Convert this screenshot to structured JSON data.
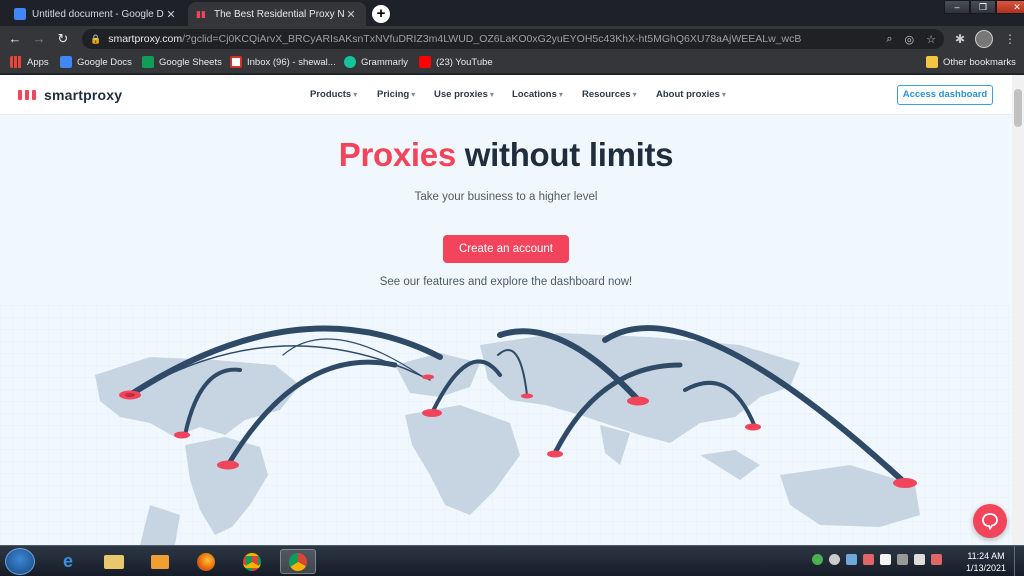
{
  "browser": {
    "tabs": [
      {
        "title": "Untitled document - Google Doc",
        "active": false
      },
      {
        "title": "The Best Residential Proxy Netw",
        "active": true
      }
    ],
    "url_host": "smartproxy.com",
    "url_rest": "/?gclid=Cj0KCQiArvX_BRCyARIsAKsnTxNVfuDRIZ3m4LWUD_OZ6LaKO0xG2yuEYOH5c43KhX-ht5MGhQ6XU78aAjWEEALw_wcB",
    "bookmarks": [
      "Apps",
      "Google Docs",
      "Google Sheets",
      "Inbox (96) - shewal...",
      "Grammarly",
      "(23) YouTube"
    ],
    "other_bookmarks": "Other bookmarks"
  },
  "site": {
    "logo": "smartproxy",
    "menu": [
      "Products",
      "Pricing",
      "Use proxies",
      "Locations",
      "Resources",
      "About proxies"
    ],
    "access_button": "Access dashboard",
    "hero_accent": "Proxies",
    "hero_rest": " without limits",
    "subtitle": "Take your business to a higher level",
    "cta": "Create an account",
    "explore": "See our features and explore the dashboard now!"
  },
  "taskbar": {
    "time": "11:24 AM",
    "date": "1/13/2021"
  },
  "colors": {
    "brand_red": "#f2445b",
    "navy": "#1f2d3d",
    "arc_blue": "#2f4a66"
  }
}
